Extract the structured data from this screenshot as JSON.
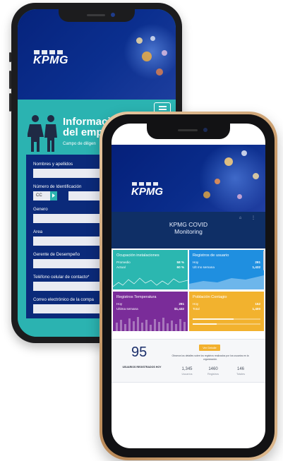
{
  "back_phone": {
    "logo": "KPMG",
    "form": {
      "title_line1": "Informació",
      "title_line2": "del emp",
      "subtitle": "Campo de diligen",
      "fields": [
        {
          "label": "Nombres y apellidos"
        },
        {
          "label": "Número de Identificación",
          "select_value": "CC"
        },
        {
          "label": "Genero"
        },
        {
          "label": "Area"
        },
        {
          "label": "Gerente de Desempeño"
        },
        {
          "label": "Teléfono celular de contacto*"
        },
        {
          "label": "Correo electrónico de la compa"
        }
      ]
    }
  },
  "front_phone": {
    "logo": "KPMG",
    "dashboard": {
      "title_line1": "KPMG COVID",
      "title_line2": "Monitoring",
      "header_icons": "⌂ ⋮",
      "cards": [
        {
          "title": "Ocupación instalaciones",
          "color": "#2bb7b0",
          "rows": [
            {
              "label": "Promedio",
              "value": "58 %"
            },
            {
              "label": "Actual",
              "value": "60 %"
            }
          ]
        },
        {
          "title": "Registros de usuario",
          "color": "#1f8fe0",
          "rows": [
            {
              "label": "Hoy",
              "value": "291"
            },
            {
              "label": "Ult mo semana",
              "value": "1,432"
            }
          ]
        },
        {
          "title": "Registros Temperatura",
          "color": "#7a2c99",
          "rows": [
            {
              "label": "Hoy",
              "value": "291"
            },
            {
              "label": "Ultima semana",
              "value": "$1,432"
            }
          ]
        },
        {
          "title": "Población Contagio",
          "color": "#f2b22e",
          "rows": [
            {
              "label": "Hoy",
              "value": "152"
            },
            {
              "label": "Total",
              "value": "1,400"
            }
          ]
        }
      ],
      "stats": {
        "main_value": "95",
        "main_caption": "USUARIOS REGISTRADOS HOY",
        "button_label": "Ver Detalle",
        "description": "Observa los detalles sobre los registros realizados por los usuarios en la organización.",
        "mini": [
          {
            "value": "1,345",
            "label": "Usuarios"
          },
          {
            "value": "1460",
            "label": "Registros"
          },
          {
            "value": "146",
            "label": "Totales"
          }
        ]
      }
    }
  }
}
